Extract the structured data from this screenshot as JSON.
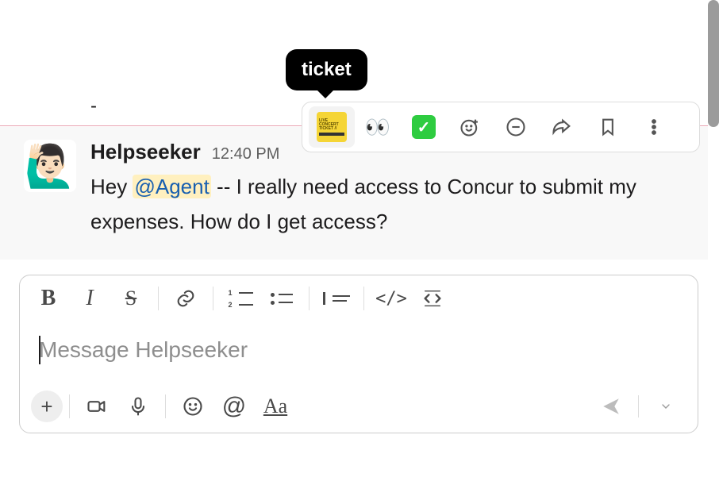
{
  "tooltip": {
    "label": "ticket"
  },
  "reactions": {
    "ticket_name": "ticket",
    "eyes_name": "eyes",
    "check_name": "white_check_mark"
  },
  "message": {
    "user": "Helpseeker",
    "timestamp": "12:40 PM",
    "text_before": "Hey ",
    "mention": "@Agent",
    "text_after": " -- I really need access to Concur to submit my expenses. How do I get access?"
  },
  "composer": {
    "placeholder": "Message Helpseeker"
  },
  "divider_char": "-"
}
